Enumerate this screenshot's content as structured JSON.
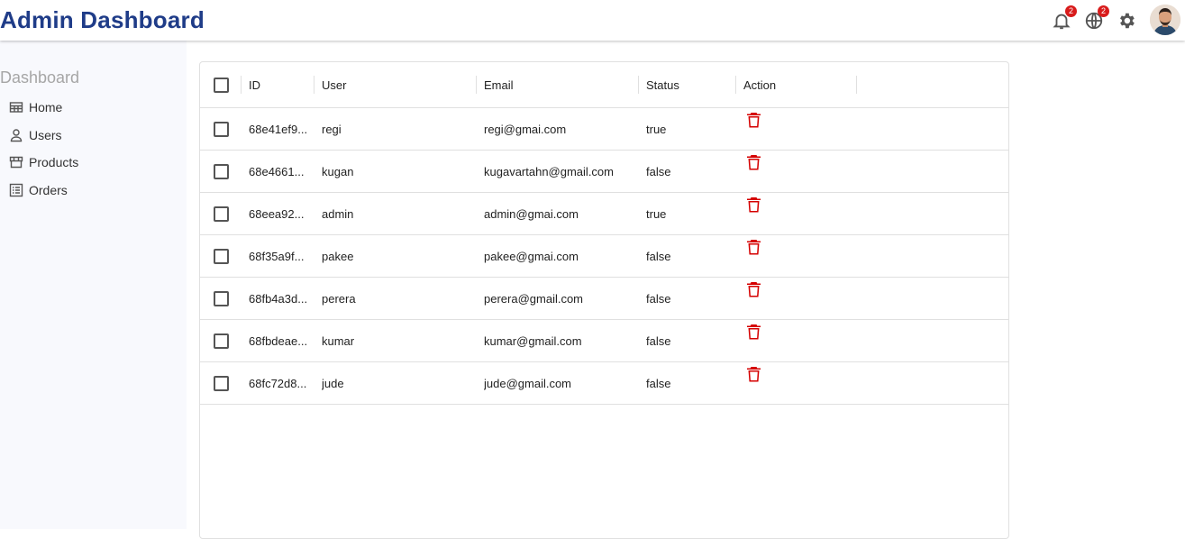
{
  "app": {
    "title": "Admin Dashboard"
  },
  "topbar": {
    "notifications": {
      "icon": "bell-icon",
      "badge": "2"
    },
    "language": {
      "icon": "globe-icon",
      "badge": "2"
    },
    "settings": {
      "icon": "gear-icon"
    },
    "avatar": {
      "icon": "user-avatar"
    }
  },
  "sidebar": {
    "heading": "Dashboard",
    "items": [
      {
        "label": "Home",
        "icon": "home-table-icon"
      },
      {
        "label": "Users",
        "icon": "user-icon"
      },
      {
        "label": "Products",
        "icon": "store-icon"
      },
      {
        "label": "Orders",
        "icon": "list-icon"
      }
    ]
  },
  "table": {
    "columns": [
      "ID",
      "User",
      "Email",
      "Status",
      "Action"
    ],
    "rows": [
      {
        "id": "68e41ef9...",
        "user": "regi",
        "email": "regi@gmai.com",
        "status": "true"
      },
      {
        "id": "68e4661...",
        "user": "kugan",
        "email": "kugavartahn@gmail.com",
        "status": "false"
      },
      {
        "id": "68eea92...",
        "user": "admin",
        "email": "admin@gmai.com",
        "status": "true"
      },
      {
        "id": "68f35a9f...",
        "user": "pakee",
        "email": "pakee@gmai.com",
        "status": "false"
      },
      {
        "id": "68fb4a3d...",
        "user": "perera",
        "email": "perera@gmail.com",
        "status": "false"
      },
      {
        "id": "68fbdeae...",
        "user": "kumar",
        "email": "kumar@gmail.com",
        "status": "false"
      },
      {
        "id": "68fc72d8...",
        "user": "jude",
        "email": "jude@gmail.com",
        "status": "false"
      }
    ],
    "action_icon": "trash-icon"
  },
  "colors": {
    "title": "#1f3c88",
    "badge": "#d81b1b",
    "delete": "#d50000",
    "sidebar_bg": "#f8f9fd"
  }
}
